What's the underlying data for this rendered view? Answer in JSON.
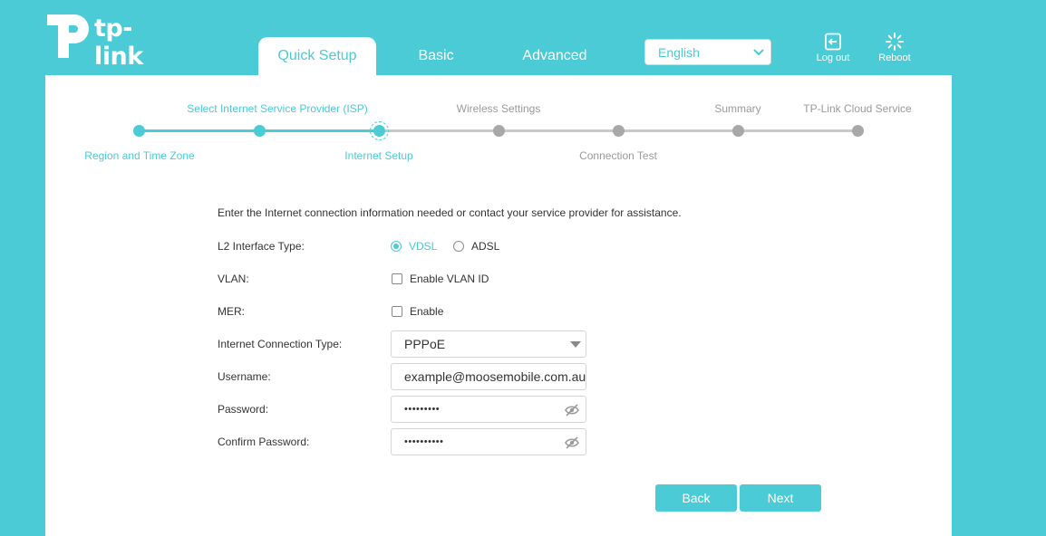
{
  "header": {
    "logo_text": "tp-link",
    "tabs": [
      {
        "label": "Quick Setup",
        "active": true
      },
      {
        "label": "Basic",
        "active": false
      },
      {
        "label": "Advanced",
        "active": false
      }
    ],
    "language": {
      "selected": "English"
    },
    "logout_label": "Log out",
    "reboot_label": "Reboot"
  },
  "stepper": {
    "steps": [
      {
        "label": "Region and Time Zone",
        "state": "done"
      },
      {
        "label": "Select Internet Service Provider (ISP)",
        "state": "done"
      },
      {
        "label": "Internet Setup",
        "state": "current"
      },
      {
        "label": "Wireless Settings",
        "state": "todo"
      },
      {
        "label": "Connection Test",
        "state": "todo"
      },
      {
        "label": "Summary",
        "state": "todo"
      },
      {
        "label": "TP-Link Cloud Service",
        "state": "todo"
      }
    ]
  },
  "form": {
    "intro": "Enter the Internet connection information needed or contact your service provider for assistance.",
    "l2_label": "L2 Interface Type:",
    "l2_options": [
      "VDSL",
      "ADSL"
    ],
    "l2_selected": "VDSL",
    "vlan_label": "VLAN:",
    "vlan_option": "Enable VLAN ID",
    "mer_label": "MER:",
    "mer_option": "Enable",
    "conn_type_label": "Internet Connection Type:",
    "conn_type_value": "PPPoE",
    "username_label": "Username:",
    "username_value": "example@moosemobile.com.au",
    "password_label": "Password:",
    "password_value": "•••••••••",
    "confirm_label": "Confirm Password:",
    "confirm_value": "••••••••••"
  },
  "buttons": {
    "back": "Back",
    "next": "Next"
  },
  "colors": {
    "accent": "#4acbd6",
    "inactive": "#c9c9c9"
  }
}
